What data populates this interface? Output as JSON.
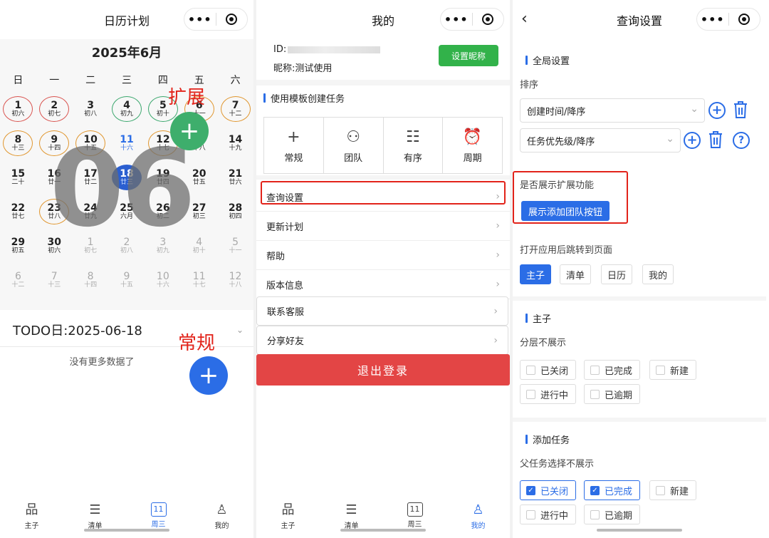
{
  "capsule": {
    "more": "•••"
  },
  "calendar_page": {
    "title": "日历计划",
    "month": "2025年6月",
    "weekdays": [
      "日",
      "一",
      "二",
      "三",
      "四",
      "五",
      "六"
    ],
    "days": [
      {
        "d": "1",
        "l": "初六",
        "ring": "#d9534f"
      },
      {
        "d": "2",
        "l": "初七",
        "ring": "#d9534f"
      },
      {
        "d": "3",
        "l": "初八"
      },
      {
        "d": "4",
        "l": "初九",
        "ring": "#3aa76d"
      },
      {
        "d": "5",
        "l": "初十",
        "ring": "#3aa76d"
      },
      {
        "d": "6",
        "l": "十一",
        "ring": "#e0962e"
      },
      {
        "d": "7",
        "l": "十二",
        "ring": "#e0962e"
      },
      {
        "d": "8",
        "l": "十三",
        "ring": "#e0962e"
      },
      {
        "d": "9",
        "l": "十四",
        "ring": "#e0962e"
      },
      {
        "d": "10",
        "l": "十五",
        "ring": "#e0962e"
      },
      {
        "d": "11",
        "l": "十六",
        "today": true
      },
      {
        "d": "12",
        "l": "十七",
        "ring": "#e0962e"
      },
      {
        "d": "13",
        "l": "十八"
      },
      {
        "d": "14",
        "l": "十九"
      },
      {
        "d": "15",
        "l": "二十"
      },
      {
        "d": "16",
        "l": "廿一"
      },
      {
        "d": "17",
        "l": "廿二"
      },
      {
        "d": "18",
        "l": "廿三",
        "selected": true
      },
      {
        "d": "19",
        "l": "廿四"
      },
      {
        "d": "20",
        "l": "廿五"
      },
      {
        "d": "21",
        "l": "廿六"
      },
      {
        "d": "22",
        "l": "廿七"
      },
      {
        "d": "23",
        "l": "廿八",
        "ring": "#e0962e"
      },
      {
        "d": "24",
        "l": "廿九"
      },
      {
        "d": "25",
        "l": "六月"
      },
      {
        "d": "26",
        "l": "初二"
      },
      {
        "d": "27",
        "l": "初三"
      },
      {
        "d": "28",
        "l": "初四"
      },
      {
        "d": "29",
        "l": "初五"
      },
      {
        "d": "30",
        "l": "初六"
      },
      {
        "d": "1",
        "l": "初七",
        "dim": true
      },
      {
        "d": "2",
        "l": "初八",
        "dim": true
      },
      {
        "d": "3",
        "l": "初九",
        "dim": true
      },
      {
        "d": "4",
        "l": "初十",
        "dim": true
      },
      {
        "d": "5",
        "l": "十一",
        "dim": true
      },
      {
        "d": "6",
        "l": "十二",
        "dim": true
      },
      {
        "d": "7",
        "l": "十三",
        "dim": true
      },
      {
        "d": "8",
        "l": "十四",
        "dim": true
      },
      {
        "d": "9",
        "l": "十五",
        "dim": true
      },
      {
        "d": "10",
        "l": "十六",
        "dim": true
      },
      {
        "d": "11",
        "l": "十七",
        "dim": true
      },
      {
        "d": "12",
        "l": "十八",
        "dim": true
      }
    ],
    "watermark": "06",
    "annot_expand": "扩展",
    "annot_normal": "常规",
    "fab_plus": "+",
    "todo": "TODO日:2025-06-18",
    "todo_caret": "⌄",
    "no_more": "没有更多数据了"
  },
  "tabbar": {
    "items": [
      {
        "label": "主子",
        "icon": "⸘"
      },
      {
        "label": "清单",
        "icon": "☰"
      },
      {
        "label": "周三",
        "icon": "▣"
      },
      {
        "label": "我的",
        "icon": "ⓞ"
      }
    ],
    "cal_day": "11"
  },
  "mine_page": {
    "title": "我的",
    "id_label": "ID:",
    "nickname": "昵称:测试使用",
    "set_nickname": "设置昵称",
    "template_title": "使用模板创建任务",
    "templates": [
      {
        "label": "常规",
        "icon": "+"
      },
      {
        "label": "团队",
        "icon": "⚇"
      },
      {
        "label": "有序",
        "icon": "☷"
      },
      {
        "label": "周期",
        "icon": "⏰"
      }
    ],
    "menu": [
      "查询设置",
      "更新计划",
      "帮助",
      "版本信息",
      "联系客服",
      "分享好友"
    ],
    "chev": "›",
    "logout": "退出登录"
  },
  "settings_page": {
    "title": "查询设置",
    "back": "‹",
    "global": "全局设置",
    "sort_label": "排序",
    "sort1": "创建时间/降序",
    "sort2": "任务优先级/降序",
    "caret": "⌄",
    "plus": "+",
    "q": "?",
    "expand_label": "是否展示扩展功能",
    "expand_btn": "展示添加团队按钮",
    "jump_label": "打开应用后跳转到页面",
    "jump_options": [
      "主子",
      "清单",
      "日历",
      "我的"
    ],
    "main_section": "主子",
    "layer_label": "分层不展示",
    "layer_options": [
      "已关闭",
      "已完成",
      "新建",
      "进行中",
      "已逾期"
    ],
    "add_section": "添加任务",
    "parent_label": "父任务选择不展示",
    "parent_options": [
      "已关闭",
      "已完成",
      "新建",
      "进行中",
      "已逾期"
    ],
    "check": "✓"
  }
}
